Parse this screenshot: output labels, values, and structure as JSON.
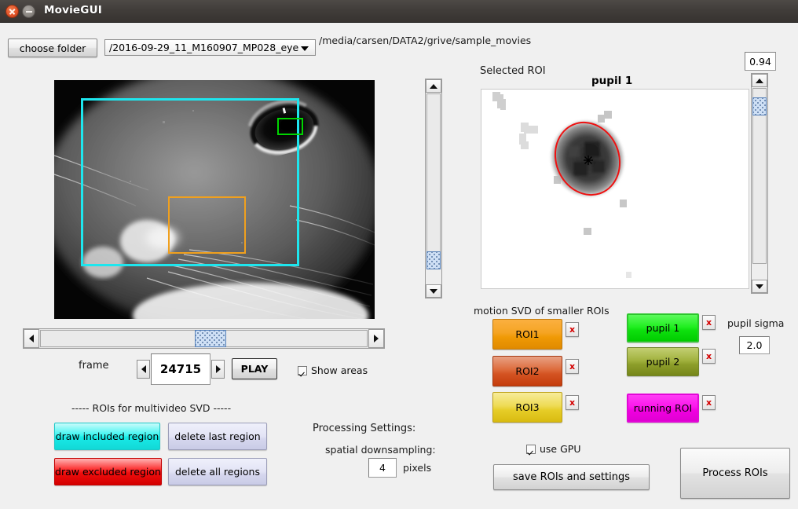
{
  "window": {
    "title": "MovieGUI",
    "close_icon": "close-icon",
    "minimize_icon": "minimize-icon"
  },
  "toolbar": {
    "choose_folder_label": "choose folder",
    "folder_combo_value": "/2016-09-29_11_M160907_MP028_eye",
    "folder_path": "/media/carsen/DATA2/grive/sample_movies"
  },
  "video": {
    "included_region_color": "#1ee6ee",
    "roi1_color": "#f0a01e",
    "pupil_color": "#00d400"
  },
  "playback": {
    "frame_label": "frame",
    "frame_value": "24715",
    "play_label": "PLAY",
    "show_areas_label": "Show areas",
    "show_areas_checked": true,
    "prev_icon": "arrow-left-icon",
    "next_icon": "arrow-right-icon"
  },
  "multivideo": {
    "section_label": "----- ROIs for multivideo SVD -----",
    "draw_included_label": "draw included region",
    "draw_excluded_label": "draw excluded region",
    "delete_last_label": "delete last region",
    "delete_all_label": "delete all regions",
    "included_color": "#1ff5f5",
    "excluded_color": "#fa0a0a"
  },
  "processing": {
    "header_label": "Processing Settings:",
    "downsampling_label": "spatial downsampling:",
    "downsampling_value": "4",
    "pixels_label": "pixels"
  },
  "selected_roi": {
    "panel_label": "Selected ROI",
    "title": "pupil 1",
    "threshold_value": "0.94",
    "ellipse_color": "#ee1111"
  },
  "roi_section": {
    "label": "motion SVD of smaller ROIs",
    "delete_icon_label": "x",
    "items": [
      {
        "label": "ROI1",
        "color_top": "#fbb040",
        "color_bottom": "#f09000",
        "border": "#c07b10"
      },
      {
        "label": "ROI2",
        "color_top": "#e07a50",
        "color_bottom": "#cf4414",
        "border": "#a63a12"
      },
      {
        "label": "ROI3",
        "color_top": "#f4e67a",
        "color_bottom": "#e2c71c",
        "border": "#bda11a"
      }
    ],
    "special": [
      {
        "label": "pupil 1",
        "color_top": "#36f536",
        "color_bottom": "#00d000",
        "border": "#2bb32b"
      },
      {
        "label": "pupil 2",
        "color_top": "#b0c050",
        "color_bottom": "#76861e",
        "border": "#72842c"
      },
      {
        "label": "running ROI",
        "color_top": "#ff2df0",
        "color_bottom": "#e600d6",
        "border": "#d300c6"
      }
    ]
  },
  "pupil_settings": {
    "sigma_label": "pupil sigma",
    "sigma_value": "2.0"
  },
  "actions": {
    "use_gpu_label": "use GPU",
    "use_gpu_checked": true,
    "save_label": "save ROIs and settings",
    "process_label": "Process ROIs"
  }
}
